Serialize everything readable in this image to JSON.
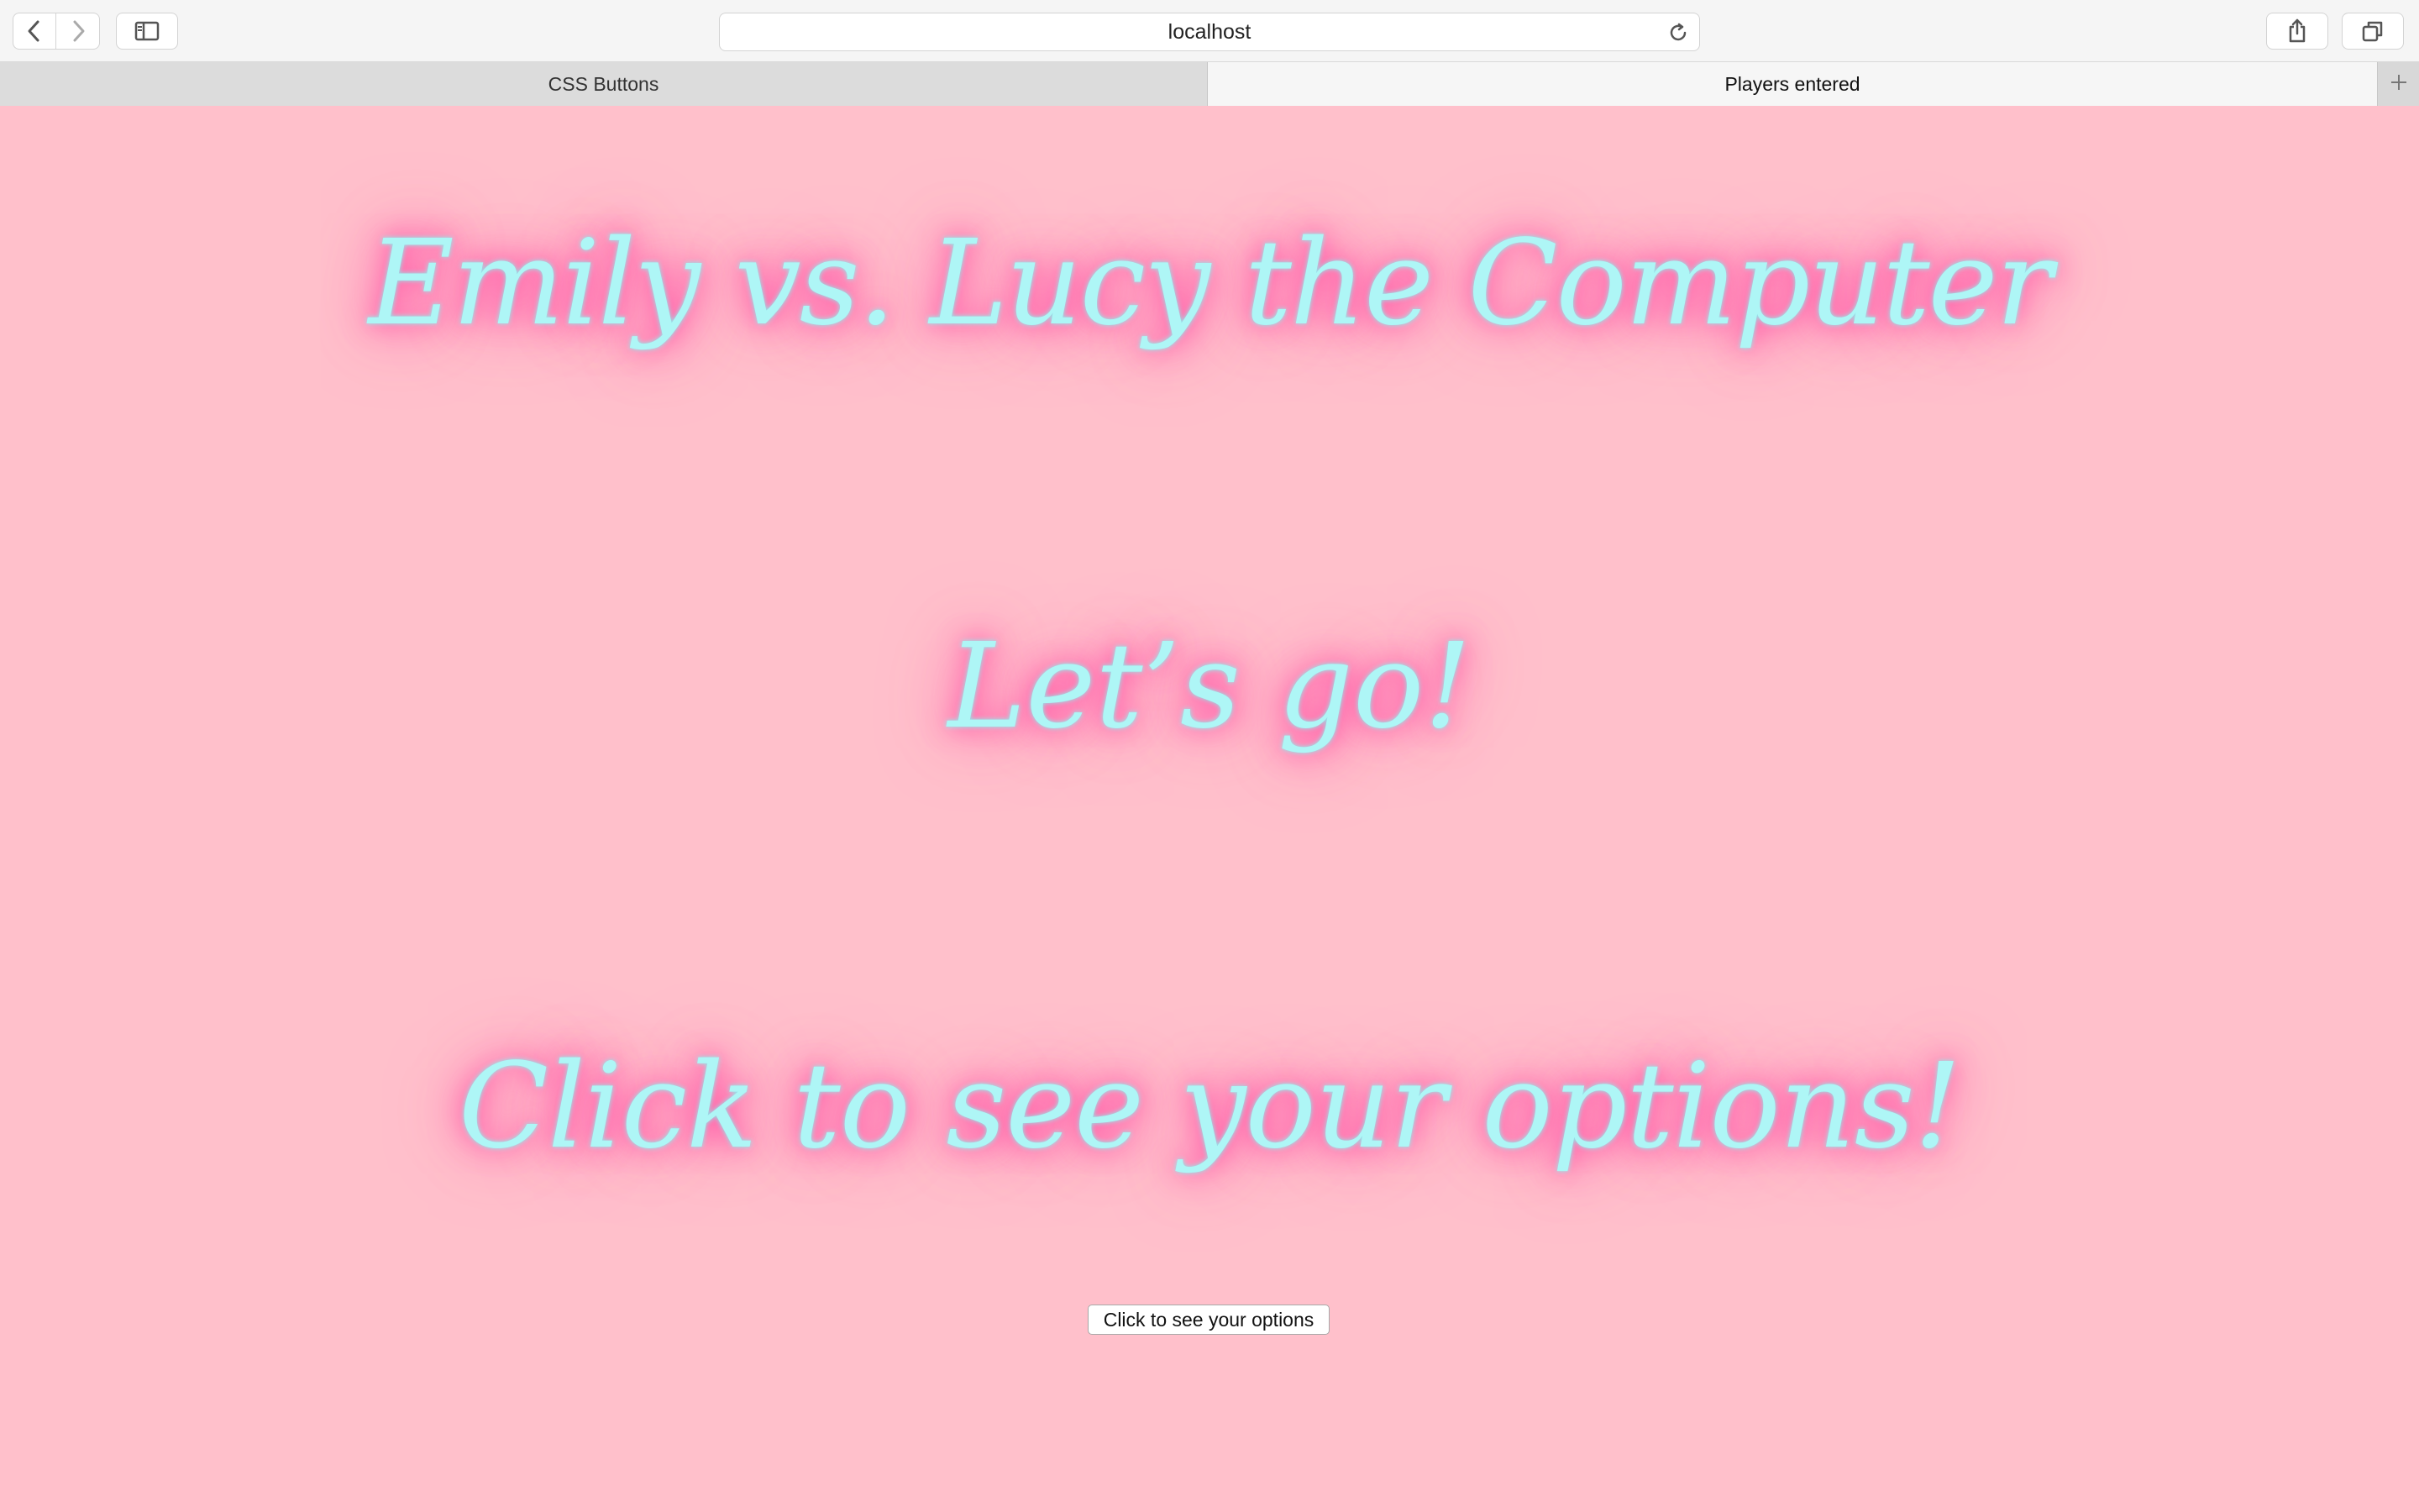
{
  "browser": {
    "address": "localhost",
    "tabs": [
      {
        "label": "CSS Buttons",
        "active": false
      },
      {
        "label": "Players entered",
        "active": true
      }
    ],
    "icons": {
      "back": "chevron-left-icon",
      "forward": "chevron-right-icon",
      "sidebar": "sidebar-icon",
      "reload": "reload-icon",
      "share": "share-icon",
      "tabs": "tabs-overview-icon",
      "new_tab": "plus-icon"
    }
  },
  "page": {
    "heading_players": "Emily vs. Lucy the Computer",
    "heading_go": "Let’s go!",
    "heading_click": "Click to see your options!",
    "options_button_label": "Click to see your options",
    "colors": {
      "background": "#ffc0cb",
      "text": "#aef6f6",
      "glow": "#ff4fa3"
    }
  }
}
